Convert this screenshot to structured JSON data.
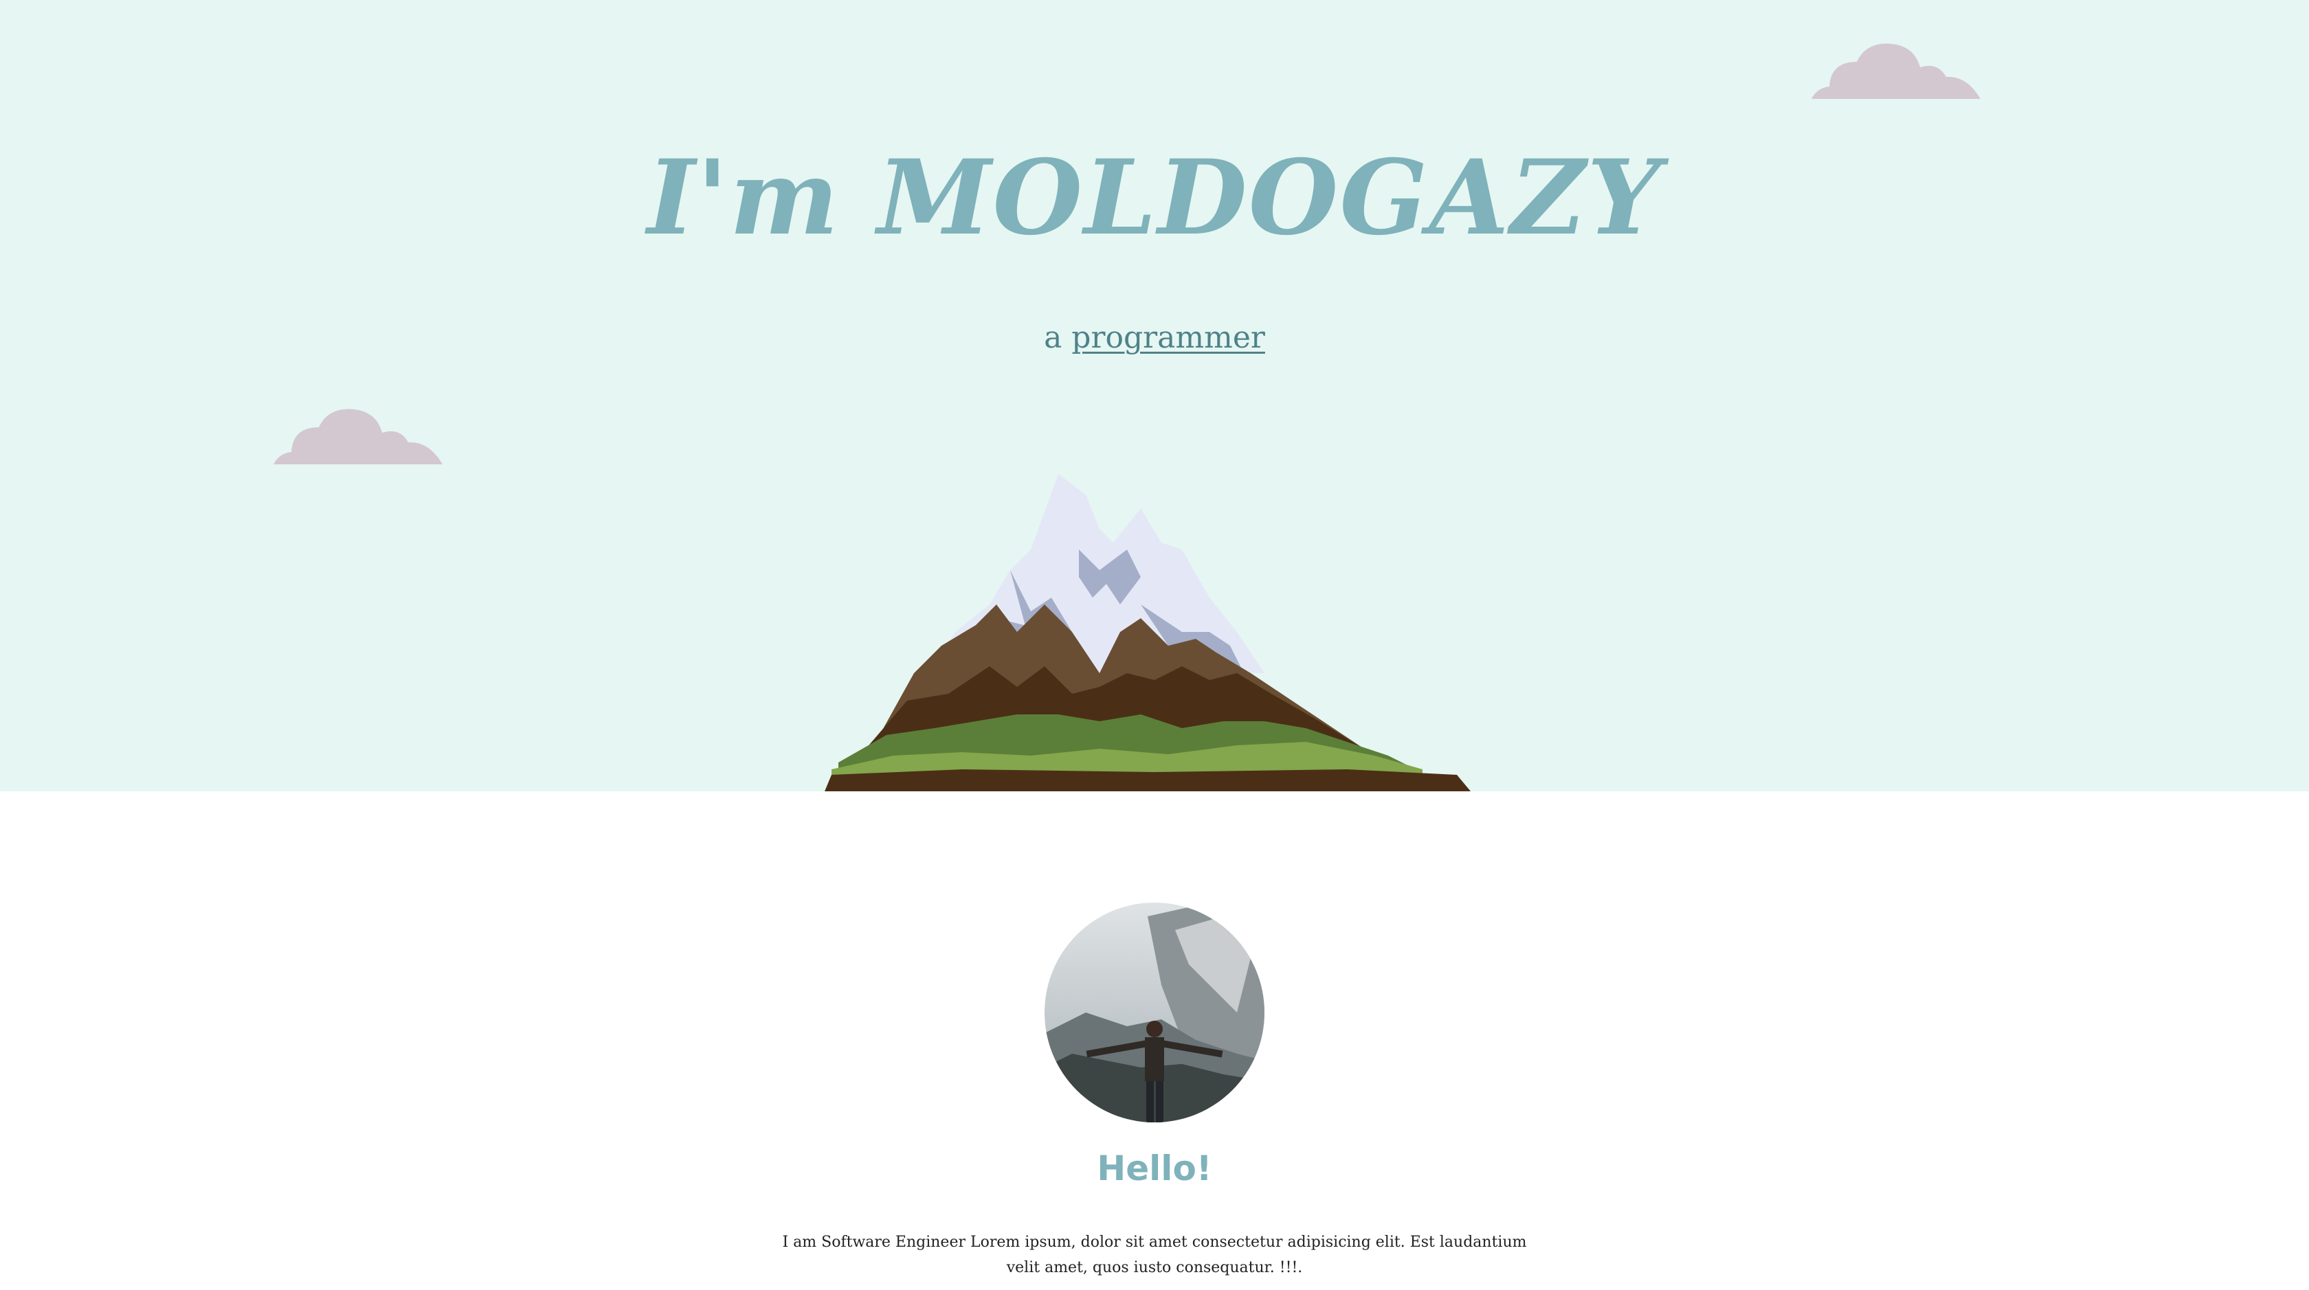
{
  "hero": {
    "title": "I'm MOLDOGAZY",
    "subtitle_prefix": "a ",
    "subtitle_role": "programmer",
    "background_color": "#e6f6f2",
    "title_color": "#7fb2ba"
  },
  "illustrations": {
    "clouds": [
      "cloud-icon",
      "cloud-icon"
    ],
    "mountain": "mountain-illustration",
    "cloud_color": "#d3c8d0"
  },
  "about": {
    "avatar_alt": "profile photo of a man with arms outstretched in front of snowy mountains",
    "greeting": "Hello!",
    "bio": "I am Software Engineer Lorem ipsum, dolor sit amet consectetur adipisicing elit. Est laudantium velit amet, quos iusto consequatur. !!!."
  }
}
